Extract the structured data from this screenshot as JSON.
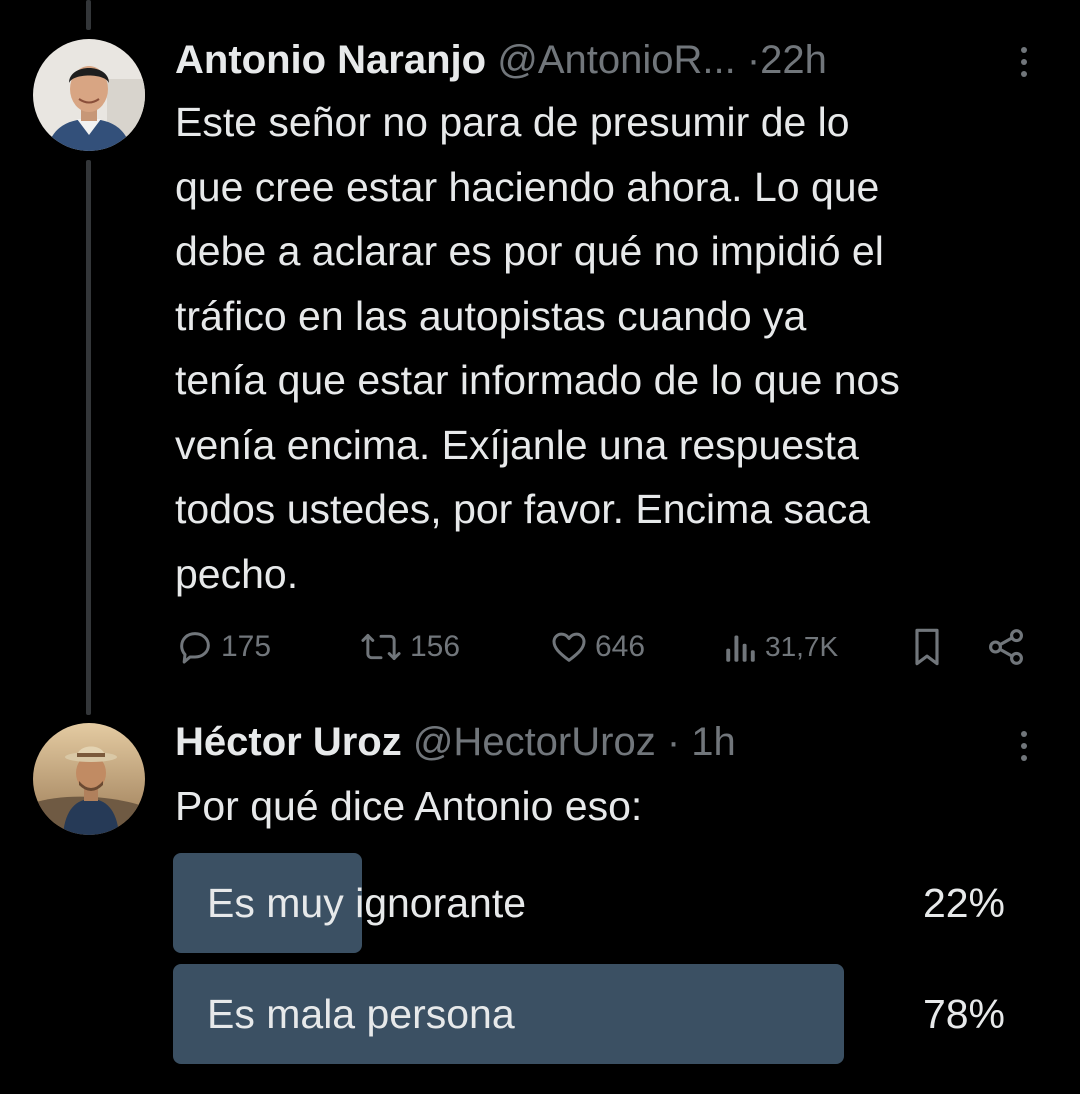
{
  "tweets": [
    {
      "display_name": "Antonio Naranjo",
      "handle": "@AntonioR...",
      "separator": "·",
      "time": "22h",
      "text": "Este señor no para de presumir de lo\nque cree estar haciendo ahora. Lo que\ndebe a aclarar es por qué no impidió el\ntráfico en las autopistas cuando ya\ntenía que estar informado de lo que nos\nvenía encima. Exíjanle una respuesta\ntodos ustedes, por favor. Encima saca\npecho.",
      "replies": "175",
      "reposts": "156",
      "likes": "646",
      "views": "31,7K",
      "icons": [
        "comment-icon",
        "retweet-icon",
        "heart-icon",
        "views-icon",
        "bookmark-icon",
        "share-icon",
        "more-icon"
      ]
    },
    {
      "display_name": "Héctor Uroz",
      "handle": "@HectorUroz",
      "separator": "·",
      "time": "1h",
      "text": "Por qué dice Antonio eso:",
      "poll": {
        "options": [
          {
            "label": "Es muy ignorante",
            "percent": "22%",
            "value": 22
          },
          {
            "label": "Es mala persona",
            "percent": "78%",
            "value": 78
          }
        ]
      }
    }
  ],
  "colors": {
    "background": "#000000",
    "text_primary": "#e7e9ea",
    "text_secondary": "#71767b",
    "poll_bar": "#3b5063",
    "thread_line": "#333639"
  }
}
